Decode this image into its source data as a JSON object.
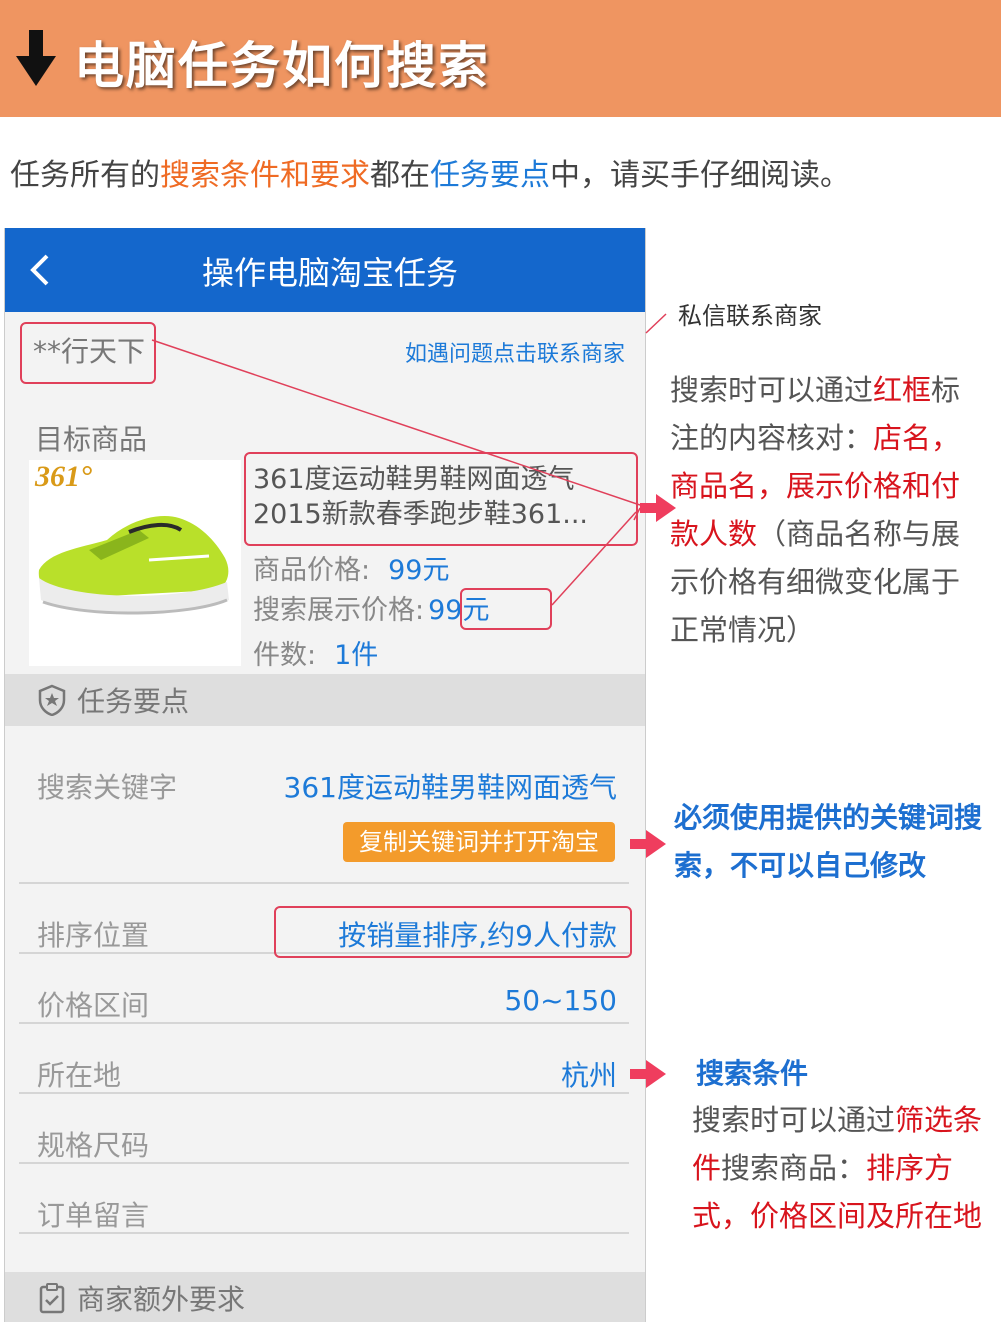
{
  "banner": {
    "title": "电脑任务如何搜索"
  },
  "intro": {
    "part1": "任务所有的",
    "highlight1": "搜索条件和要求",
    "part2": "都在",
    "highlight2": "任务要点",
    "part3": "中，请买手仔细阅读。"
  },
  "app": {
    "title": "操作电脑淘宝任务",
    "shop_name": "**行天下",
    "contact_link": "如遇问题点击联系商家",
    "target_label": "目标商品",
    "product": {
      "brand_logo": "361°",
      "name_line1": "361度运动鞋男鞋网面透气",
      "name_line2": "2015新款春季跑步鞋361...",
      "price_label": "商品价格:",
      "price_value": "99元",
      "display_price_label": "搜索展示价格:",
      "display_price_value": "99元",
      "quantity_label": "件数:",
      "quantity_value": "1件"
    },
    "task_points_label": "任务要点",
    "keyword_label": "搜索关键字",
    "keyword_value": "361度运动鞋男鞋网面透气",
    "copy_button": "复制关键词并打开淘宝",
    "rows": [
      {
        "label": "排序位置",
        "value": "按销量排序,约9人付款"
      },
      {
        "label": "价格区间",
        "value": "50~150"
      },
      {
        "label": "所在地",
        "value": "杭州"
      },
      {
        "label": "规格尺码",
        "value": ""
      },
      {
        "label": "订单留言",
        "value": ""
      }
    ],
    "extra_label": "商家额外要求"
  },
  "annotations": {
    "contact_note": "私信联系商家",
    "verify": {
      "p1": "搜索时可以通过",
      "r1": "红框",
      "p2": "标注的内容核对：",
      "r2": "店名，商品名，展示价格和付款人数",
      "p3": "（商品名称与展示价格有细微变化属于正常情况）"
    },
    "keyword_note_line1": "必须使用提供的关键词搜",
    "keyword_note_line2": "索，不可以自己修改",
    "filter_title": "搜索条件",
    "filter": {
      "p1": "搜索时可以通过",
      "r1": "筛选条件",
      "p2": "搜索商品：",
      "r2": "排序方式，价格区间及所在地"
    }
  },
  "colors": {
    "banner": "#ef9561",
    "appbar": "#1467cc",
    "accent_blue": "#1d7ad8",
    "accent_red": "#d8141d",
    "button_orange": "#f39b2b",
    "box_red": "#e0405a"
  },
  "icons": [
    "down-arrow-icon",
    "back-chevron-icon",
    "shield-star-icon",
    "clipboard-icon",
    "right-arrow-icon"
  ]
}
